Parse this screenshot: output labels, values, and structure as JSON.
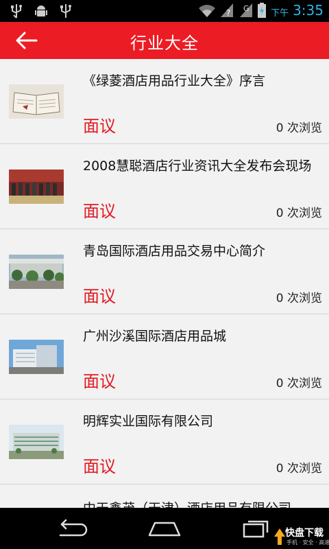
{
  "status_bar": {
    "icons_left": [
      "usb-icon",
      "android-debug-icon",
      "usb-icon"
    ],
    "icons_right": [
      "wifi-icon",
      "signal-unknown-icon",
      "signal-g-icon",
      "battery-charging-icon"
    ],
    "network_label": "G",
    "ampm": "下午",
    "time": "3:35"
  },
  "app_bar": {
    "title": "行业大全",
    "back_icon": "arrow-left-icon",
    "background_color": "#ec1c24"
  },
  "list": {
    "items": [
      {
        "title": "《绿菱酒店用品行业大全》序言",
        "price": "面议",
        "views": "0 次浏览",
        "image": "open-book-image"
      },
      {
        "title": "2008慧聪酒店行业资讯大全发布会现场",
        "price": "面议",
        "views": "0 次浏览",
        "image": "conference-stage-image"
      },
      {
        "title": "青岛国际酒店用品交易中心简介",
        "price": "面议",
        "views": "0 次浏览",
        "image": "trade-center-building-image"
      },
      {
        "title": "广州沙溪国际酒店用品城",
        "price": "面议",
        "views": "0 次浏览",
        "image": "hotel-supplies-city-image"
      },
      {
        "title": "明辉实业国际有限公司",
        "price": "面议",
        "views": "0 次浏览",
        "image": "company-building-image"
      },
      {
        "title": "中天鑫茂（天津）酒店用品有限公司",
        "price": "",
        "views": "",
        "image": ""
      }
    ],
    "price_color": "#e11a22"
  },
  "nav_bar": {
    "buttons": [
      "back-nav-icon",
      "home-nav-icon",
      "recents-nav-icon"
    ],
    "watermark_main": "快盘下载",
    "watermark_sub": "手机 · 安全 · 高速"
  }
}
